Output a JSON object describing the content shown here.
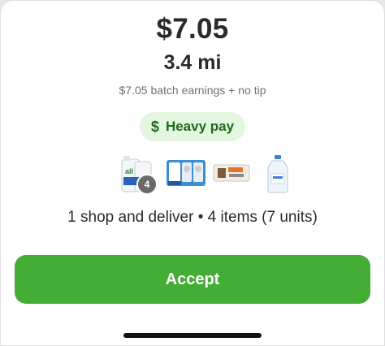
{
  "offer": {
    "price": "$7.05",
    "distance": "3.4 mi",
    "earnings_note": "$7.05 batch earnings + no tip",
    "badge": {
      "icon": "dollar-sign-icon",
      "icon_glyph": "$",
      "label": "Heavy pay"
    },
    "products": [
      {
        "name": "laundry-detergent-product-image",
        "quantity": "4"
      },
      {
        "name": "paper-towels-product-image"
      },
      {
        "name": "food-storage-box-product-image"
      },
      {
        "name": "water-jug-product-image"
      }
    ],
    "summary": "1 shop and deliver • 4 items (7 units)",
    "accept_label": "Accept"
  },
  "colors": {
    "accent": "#43ad36",
    "badge_bg": "#e2f6e0",
    "badge_text": "#1f6b1a",
    "text": "#2a2a2a",
    "muted": "#707070"
  }
}
